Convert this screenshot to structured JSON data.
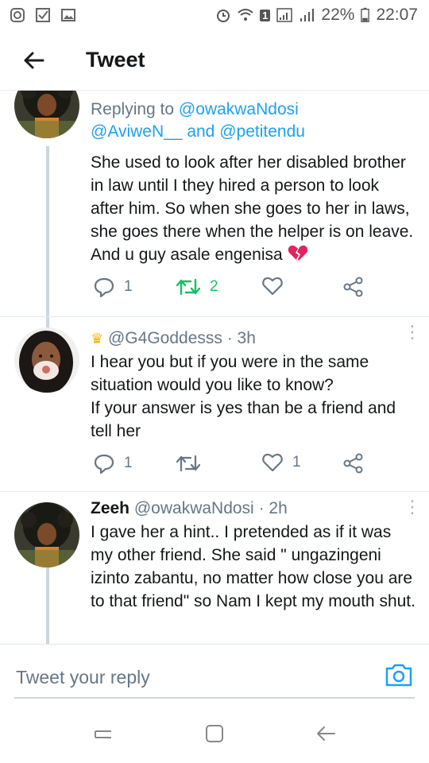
{
  "status_bar": {
    "battery": "22%",
    "time": "22:07",
    "sim_badge": "1"
  },
  "header": {
    "title": "Tweet"
  },
  "tweets": [
    {
      "replying_prefix": "Replying to ",
      "replying_user1": "@owakwaNdosi",
      "replying_user2": "@AviweN__",
      "replying_and": " and ",
      "replying_user3": "@petitendu",
      "text": "She used to look after her disabled brother in law until I they hired a person to look after him. So when she goes to her in laws, she goes there when the helper is on leave. And u guy asale engenisa",
      "replies": "1",
      "retweets": "2",
      "emoji": "broken-heart-icon"
    },
    {
      "handle": "@G4Goddesss",
      "time": " · 3h",
      "text_line1": "I hear you but if you were in the same situation would you like to know?",
      "text_line2": "If your answer is yes than be a friend and tell her",
      "replies": "1",
      "likes": "1"
    },
    {
      "name": "Zeeh",
      "handle": " @owakwaNdosi",
      "time": " · 2h",
      "text": "I gave her a hint.. I pretended as if it was my other friend. She said \" ungazingeni izinto zabantu, no matter how close you are to that friend\" so Nam I kept my mouth shut."
    }
  ],
  "reply_bar": {
    "placeholder": "Tweet your reply"
  },
  "colors": {
    "accent": "#1da1f2",
    "retweet_active": "#17bf63",
    "muted": "#657786"
  }
}
